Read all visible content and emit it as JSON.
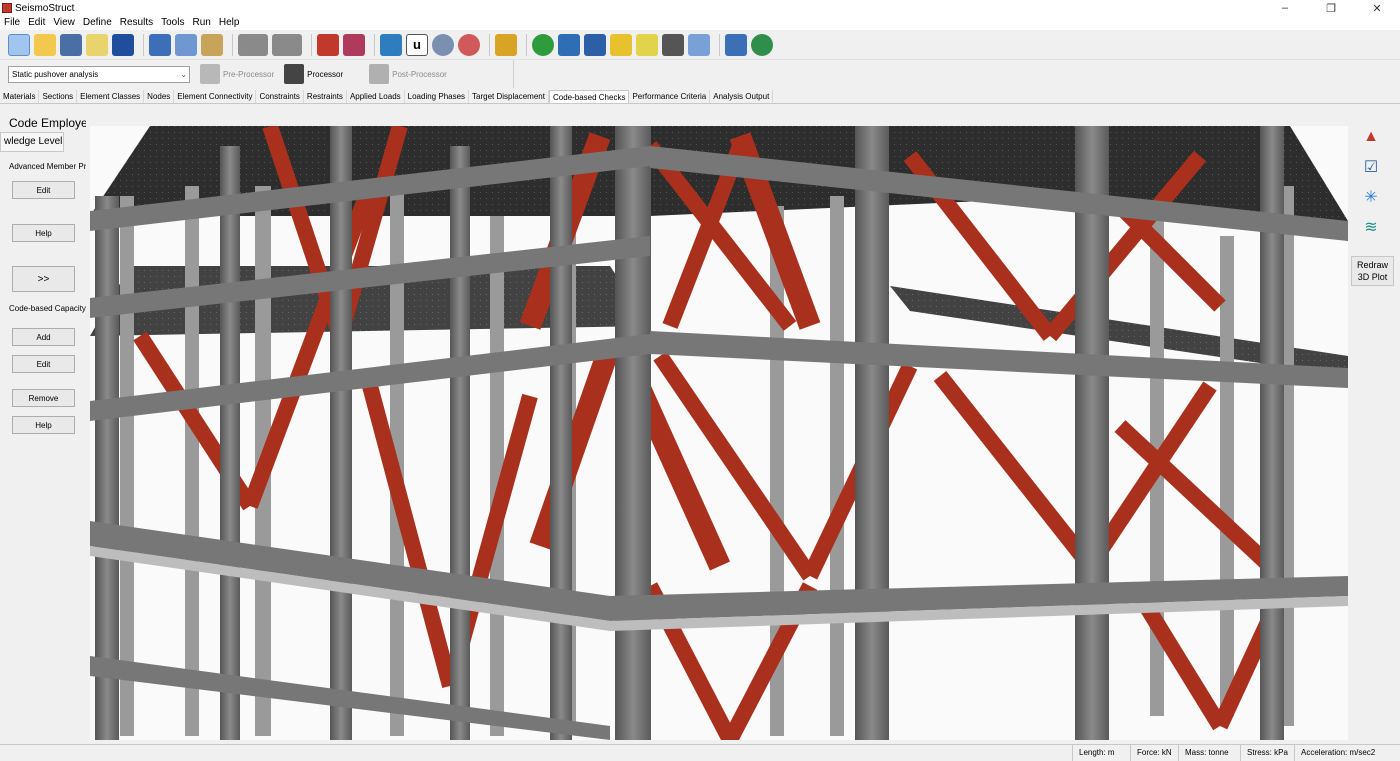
{
  "app": {
    "title": "SeismoStruct"
  },
  "window_controls": {
    "minimize": "–",
    "maximize": "❐",
    "close": "✕"
  },
  "menu": [
    "File",
    "Edit",
    "View",
    "Define",
    "Results",
    "Tools",
    "Run",
    "Help"
  ],
  "toolbar": {
    "icons": [
      "new-file-icon",
      "open-folder-icon",
      "building-wizard-icon",
      "magic-wand-icon",
      "save-icon",
      "copy-icon",
      "paste-icon",
      "clipboard-icon",
      "undo-icon",
      "redo-icon",
      "pre-view-icon",
      "run-view-icon",
      "connect-icon",
      "units-icon",
      "settings-gear-icon",
      "advanced-gear-icon",
      "brush-icon",
      "help-icon",
      "book-icon",
      "book-blue-icon",
      "folder-note-icon",
      "note-icon",
      "film-icon",
      "link-icon",
      "edit-note-icon",
      "globe-icon"
    ],
    "units_label": "u"
  },
  "module_bar": {
    "analysis_type": "Static pushover analysis",
    "pre_processor": "Pre-Processor",
    "processor": "Processor",
    "post_processor": "Post-Processor"
  },
  "tabs": [
    "Materials",
    "Sections",
    "Element Classes",
    "Nodes",
    "Element Connectivity",
    "Constraints",
    "Restraints",
    "Applied Loads",
    "Loading Phases",
    "Target Displacement",
    "Code-based Checks",
    "Performance Criteria",
    "Analysis Output"
  ],
  "active_tab": "Code-based Checks",
  "left_panel": {
    "title": "Code Employe",
    "knowledge_button": "wledge Level",
    "advanced_label": "Advanced Member Pr",
    "edit_label": "Edit",
    "help_label": "Help",
    "next_label": ">>",
    "capacity_label": "Code-based Capacity",
    "add_label": "Add",
    "edit2_label": "Edit",
    "remove_label": "Remove",
    "help2_label": "Help"
  },
  "right_panel": {
    "icons": [
      "shapes-icon",
      "checklist-icon",
      "axes-icon",
      "layers-icon"
    ],
    "redraw_line1": "Redraw",
    "redraw_line2": "3D Plot"
  },
  "status": {
    "length": "Length: m",
    "force": "Force: kN",
    "mass": "Mass: tonne",
    "stress": "Stress: kPa",
    "acceleration": "Acceleration: m/sec2"
  },
  "colors": {
    "brace": "#a8301c",
    "frame": "#6f6f6f",
    "slab": "#2a2a2a"
  }
}
